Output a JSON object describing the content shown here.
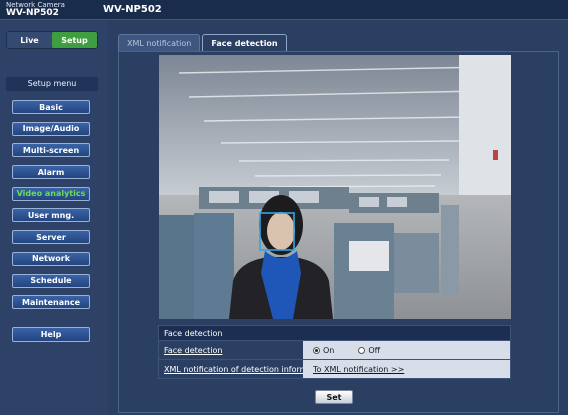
{
  "header": {
    "brand_line1": "Network Camera",
    "brand_line2": "WV-NP502",
    "model": "WV-NP502"
  },
  "mode": {
    "live_label": "Live",
    "setup_label": "Setup"
  },
  "sidebar": {
    "title": "Setup menu",
    "items": [
      {
        "label": "Basic"
      },
      {
        "label": "Image/Audio"
      },
      {
        "label": "Multi-screen"
      },
      {
        "label": "Alarm"
      },
      {
        "label": "Video analytics"
      },
      {
        "label": "User mng."
      },
      {
        "label": "Server"
      },
      {
        "label": "Network"
      },
      {
        "label": "Schedule"
      },
      {
        "label": "Maintenance"
      }
    ],
    "active_item": "Video analytics",
    "help_label": "Help"
  },
  "tabs": [
    {
      "label": "XML notification"
    },
    {
      "label": "Face detection"
    }
  ],
  "active_tab": "Face detection",
  "settings": {
    "header": "Face detection",
    "face_detection_label": "Face detection",
    "option_on": "On",
    "option_off": "Off",
    "selected": "On",
    "xml_label": "XML notification of detection information",
    "xml_link": "To XML notification >>"
  },
  "set_button": "Set",
  "colors": {
    "accent_green": "#3f9e3f",
    "active_text": "#6cdb5c",
    "background": "#2b3f63"
  }
}
